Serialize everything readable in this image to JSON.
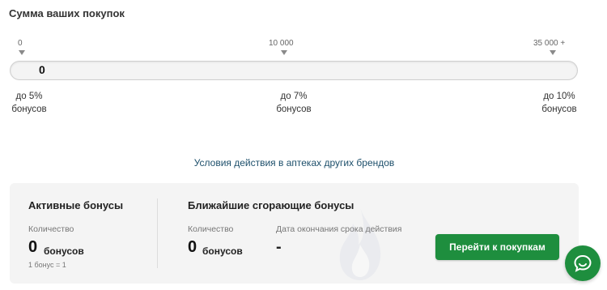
{
  "summary": {
    "title": "Сумма ваших покупок",
    "current_amount": "0",
    "progress_fraction": 0
  },
  "scale": {
    "marks": [
      "0",
      "10 000",
      "35 000 +"
    ],
    "tiers": [
      {
        "line1": "до 5%",
        "line2": "бонусов"
      },
      {
        "line1": "до 7%",
        "line2": "бонусов"
      },
      {
        "line1": "до 10%",
        "line2": "бонусов"
      }
    ]
  },
  "conditions_link": "Условия действия в аптеках других брендов",
  "active_bonuses": {
    "title": "Активные бонусы",
    "quantity_label": "Количество",
    "value": "0",
    "unit": "бонусов",
    "rate_note": "1 бонус = 1"
  },
  "expiring_bonuses": {
    "title": "Ближайшие сгорающие бонусы",
    "quantity_label": "Количество",
    "value": "0",
    "unit": "бонусов",
    "expiry_label": "Дата окончания срока действия",
    "expiry_value": "-"
  },
  "cta_label": "Перейти к покупкам",
  "icons": {
    "watermark": "flame-icon",
    "chat": "chat-bubble-icon"
  },
  "colors": {
    "accent_green": "#1e8e3e",
    "link_blue": "#1d4f6b",
    "panel_bg": "#f4f4f4"
  }
}
